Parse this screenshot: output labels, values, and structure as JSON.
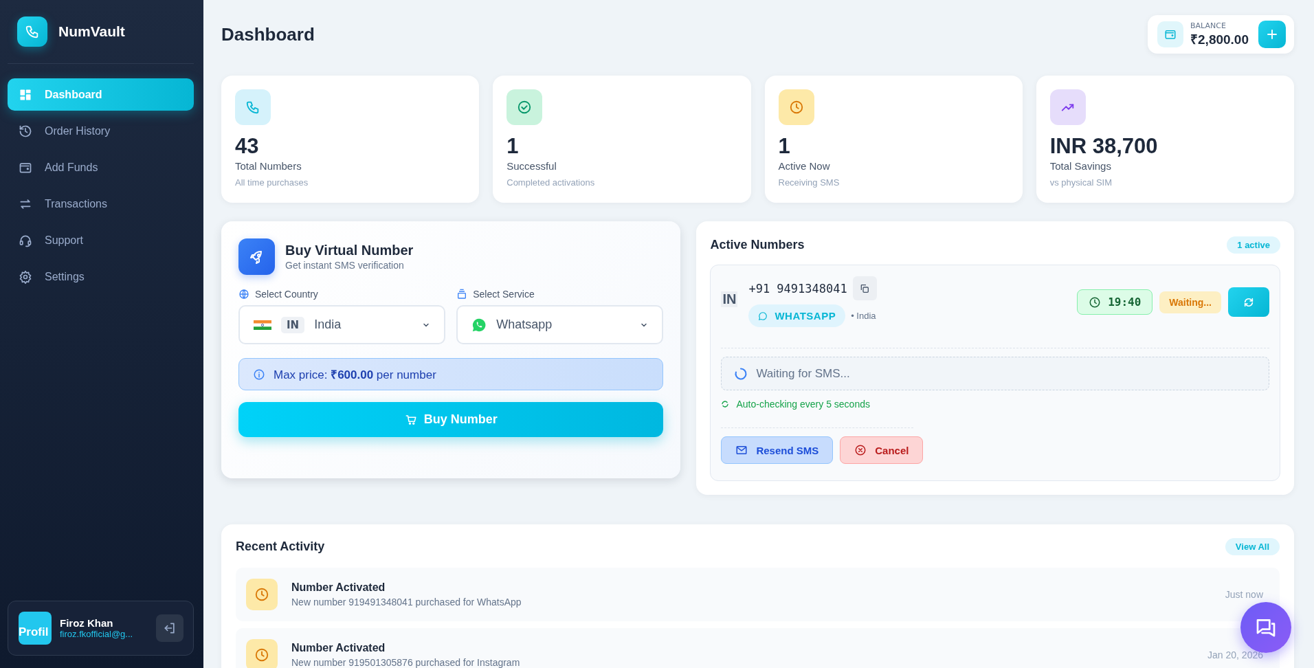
{
  "brand": {
    "name": "NumVault"
  },
  "nav": [
    {
      "label": "Dashboard",
      "selected": true
    },
    {
      "label": "Order History",
      "selected": false
    },
    {
      "label": "Add Funds",
      "selected": false
    },
    {
      "label": "Transactions",
      "selected": false
    },
    {
      "label": "Support",
      "selected": false
    },
    {
      "label": "Settings",
      "selected": false
    }
  ],
  "user": {
    "avatar_alt": "Profil",
    "name": "Firoz Khan",
    "email": "firoz.fkofficial@g..."
  },
  "page_title": "Dashboard",
  "balance": {
    "label": "BALANCE",
    "amount": "₹2,800.00"
  },
  "stats": [
    {
      "kind": "phone",
      "value": "43",
      "label": "Total Numbers",
      "sub": "All time purchases"
    },
    {
      "kind": "check",
      "value": "1",
      "label": "Successful",
      "sub": "Completed activations"
    },
    {
      "kind": "clock",
      "value": "1",
      "label": "Active Now",
      "sub": "Receiving SMS"
    },
    {
      "kind": "trend",
      "value": "INR 38,700",
      "label": "Total Savings",
      "sub": "vs physical SIM"
    }
  ],
  "buy": {
    "title": "Buy Virtual Number",
    "subtitle": "Get instant SMS verification",
    "country_label": "Select Country",
    "country_code": "IN",
    "country": "India",
    "service_label": "Select Service",
    "service": "Whatsapp",
    "price_note": "Max price: **₹600.00** per number",
    "button": "Buy Number"
  },
  "active": {
    "title": "Active Numbers",
    "badge": "1 active",
    "numbers": [
      {
        "country_code": "IN",
        "number": "+91 9491348041",
        "service": "WHATSAPP",
        "country": "• India",
        "timer": "19:40",
        "status": "Waiting...",
        "message": "Waiting for SMS...",
        "auto_note": "Auto-checking every 5 seconds",
        "actions": [
          {
            "kind": "resend",
            "label": "Resend SMS"
          },
          {
            "kind": "cancel",
            "label": "Cancel"
          }
        ]
      }
    ]
  },
  "recent": {
    "title": "Recent Activity",
    "view_all": "View All",
    "items": [
      {
        "title": "Number Activated",
        "detail": "New number 919491348041 purchased for WhatsApp",
        "time": "Just now"
      },
      {
        "title": "Number Activated",
        "detail": "New number 919501305876 purchased for Instagram",
        "time": "Jan 20, 2026"
      }
    ]
  }
}
